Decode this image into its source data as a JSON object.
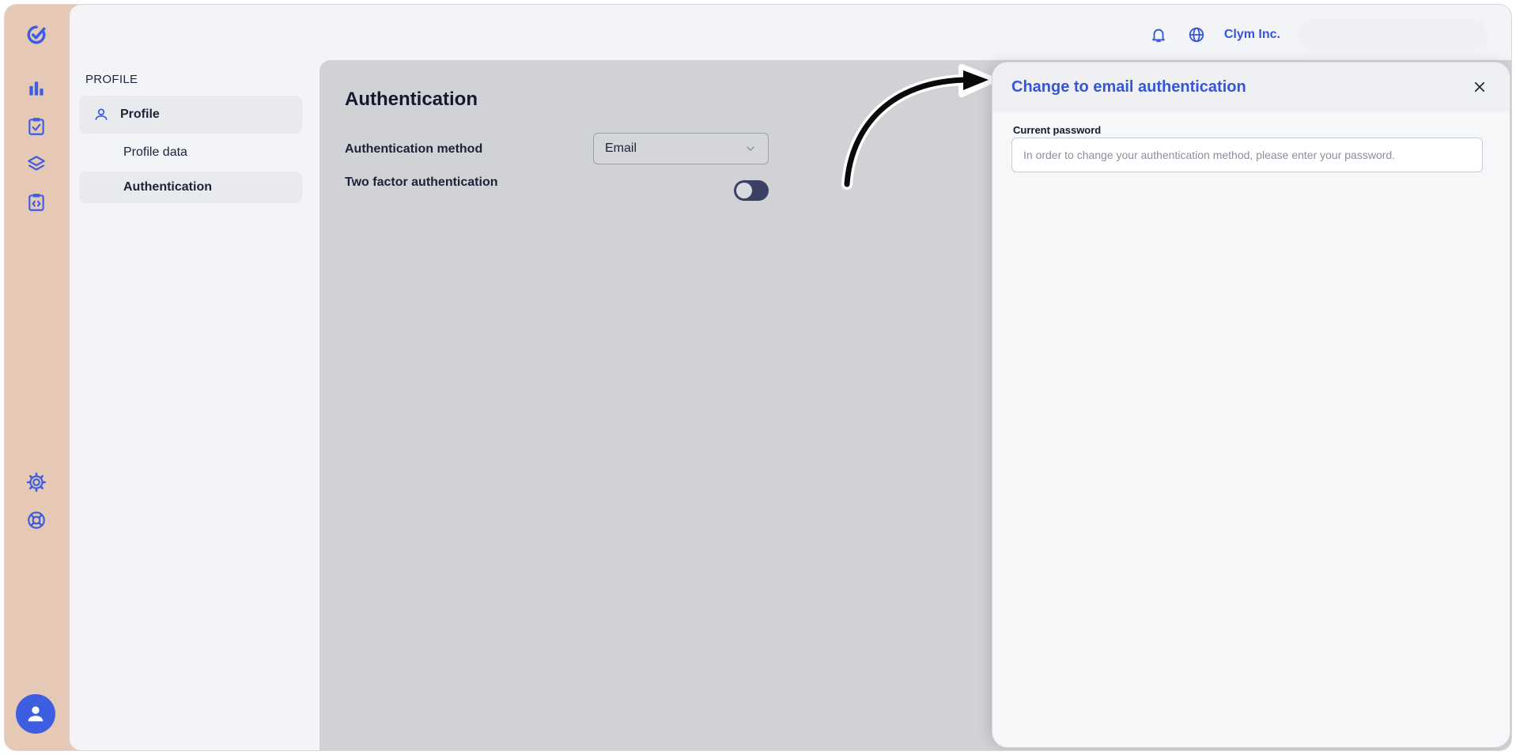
{
  "colors": {
    "accent": "#3556d6",
    "rail_bg": "#e6c8b6",
    "toggle_track": "#3b4064"
  },
  "rail": {
    "logo": "brand-logo-icon",
    "items": [
      "bar-chart-icon",
      "checklist-icon",
      "layers-icon",
      "code-clipboard-icon"
    ],
    "bottom_items": [
      "settings-gear-icon",
      "lifebuoy-icon"
    ],
    "avatar": "user-avatar-icon"
  },
  "topbar": {
    "org_name": "Clym Inc."
  },
  "subnav": {
    "section_title": "PROFILE",
    "parent_label": "Profile",
    "items": [
      {
        "label": "Profile data",
        "active": false
      },
      {
        "label": "Authentication",
        "active": true
      }
    ]
  },
  "content": {
    "title": "Authentication",
    "method_label": "Authentication method",
    "method_value": "Email",
    "two_factor_label": "Two factor authentication",
    "two_factor_enabled": false
  },
  "drawer": {
    "title": "Change to email authentication",
    "password_label": "Current password",
    "password_placeholder": "In order to change your authentication method, please enter your password.",
    "password_value": ""
  }
}
